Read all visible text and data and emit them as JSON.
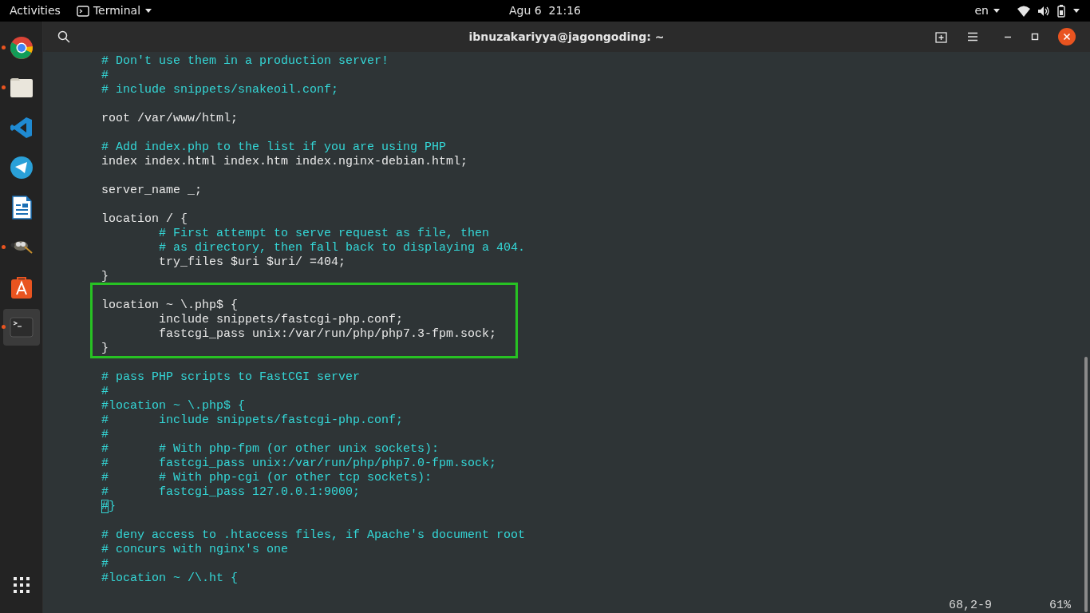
{
  "top_bar": {
    "activities": "Activities",
    "app_menu": "Terminal",
    "clock": "Agu 6  21:16",
    "language": "en"
  },
  "dock": {
    "items": [
      {
        "kind": "browser",
        "running": true,
        "selected": false
      },
      {
        "kind": "folder",
        "running": true,
        "selected": false
      },
      {
        "kind": "code-editor",
        "running": false,
        "selected": false
      },
      {
        "kind": "messenger",
        "running": false,
        "selected": false
      },
      {
        "kind": "document",
        "running": false,
        "selected": false
      },
      {
        "kind": "mascot",
        "running": true,
        "selected": false
      },
      {
        "kind": "store",
        "running": false,
        "selected": false
      },
      {
        "kind": "terminal",
        "running": true,
        "selected": true
      }
    ]
  },
  "window": {
    "title": "ibnuzakariyya@jagongoding: ~"
  },
  "editor": {
    "lines": [
      {
        "kind": "comment",
        "text": "# Don't use them in a production server!"
      },
      {
        "kind": "comment",
        "text": "#"
      },
      {
        "kind": "comment",
        "text": "# include snippets/snakeoil.conf;"
      },
      {
        "kind": "blank"
      },
      {
        "kind": "code",
        "text": "root /var/www/html;"
      },
      {
        "kind": "blank"
      },
      {
        "kind": "comment",
        "text": "# Add index.php to the list if you are using PHP"
      },
      {
        "kind": "code",
        "text": "index index.html index.htm index.nginx-debian.html;"
      },
      {
        "kind": "blank"
      },
      {
        "kind": "code",
        "text": "server_name _;"
      },
      {
        "kind": "blank"
      },
      {
        "kind": "code",
        "text": "location / {"
      },
      {
        "kind": "comment",
        "text": "        # First attempt to serve request as file, then"
      },
      {
        "kind": "comment",
        "text": "        # as directory, then fall back to displaying a 404."
      },
      {
        "kind": "code",
        "text": "        try_files $uri $uri/ =404;"
      },
      {
        "kind": "code",
        "text": "}"
      },
      {
        "kind": "blank"
      },
      {
        "kind": "code",
        "text": "location ~ \\.php$ {",
        "highlighted": true
      },
      {
        "kind": "code",
        "text": "        include snippets/fastcgi-php.conf;",
        "highlighted": true
      },
      {
        "kind": "code",
        "text": "        fastcgi_pass unix:/var/run/php/php7.3-fpm.sock;",
        "highlighted": true
      },
      {
        "kind": "code",
        "text": "}",
        "highlighted": true
      },
      {
        "kind": "blank"
      },
      {
        "kind": "comment",
        "text": "# pass PHP scripts to FastCGI server"
      },
      {
        "kind": "comment",
        "text": "#"
      },
      {
        "kind": "comment",
        "text": "#location ~ \\.php$ {"
      },
      {
        "kind": "comment",
        "text": "#       include snippets/fastcgi-php.conf;"
      },
      {
        "kind": "comment",
        "text": "#"
      },
      {
        "kind": "comment",
        "text": "#       # With php-fpm (or other unix sockets):"
      },
      {
        "kind": "comment",
        "text": "#       fastcgi_pass unix:/var/run/php/php7.0-fpm.sock;"
      },
      {
        "kind": "comment",
        "text": "#       # With php-cgi (or other tcp sockets):"
      },
      {
        "kind": "comment",
        "text": "#       fastcgi_pass 127.0.0.1:9000;"
      },
      {
        "kind": "comment",
        "text": "#}",
        "cursor": true
      },
      {
        "kind": "blank"
      },
      {
        "kind": "comment",
        "text": "# deny access to .htaccess files, if Apache's document root"
      },
      {
        "kind": "comment",
        "text": "# concurs with nginx's one"
      },
      {
        "kind": "comment",
        "text": "#"
      },
      {
        "kind": "comment",
        "text": "#location ~ /\\.ht {"
      }
    ]
  },
  "status_line": {
    "position": "68,2-9",
    "scroll": "61%"
  }
}
